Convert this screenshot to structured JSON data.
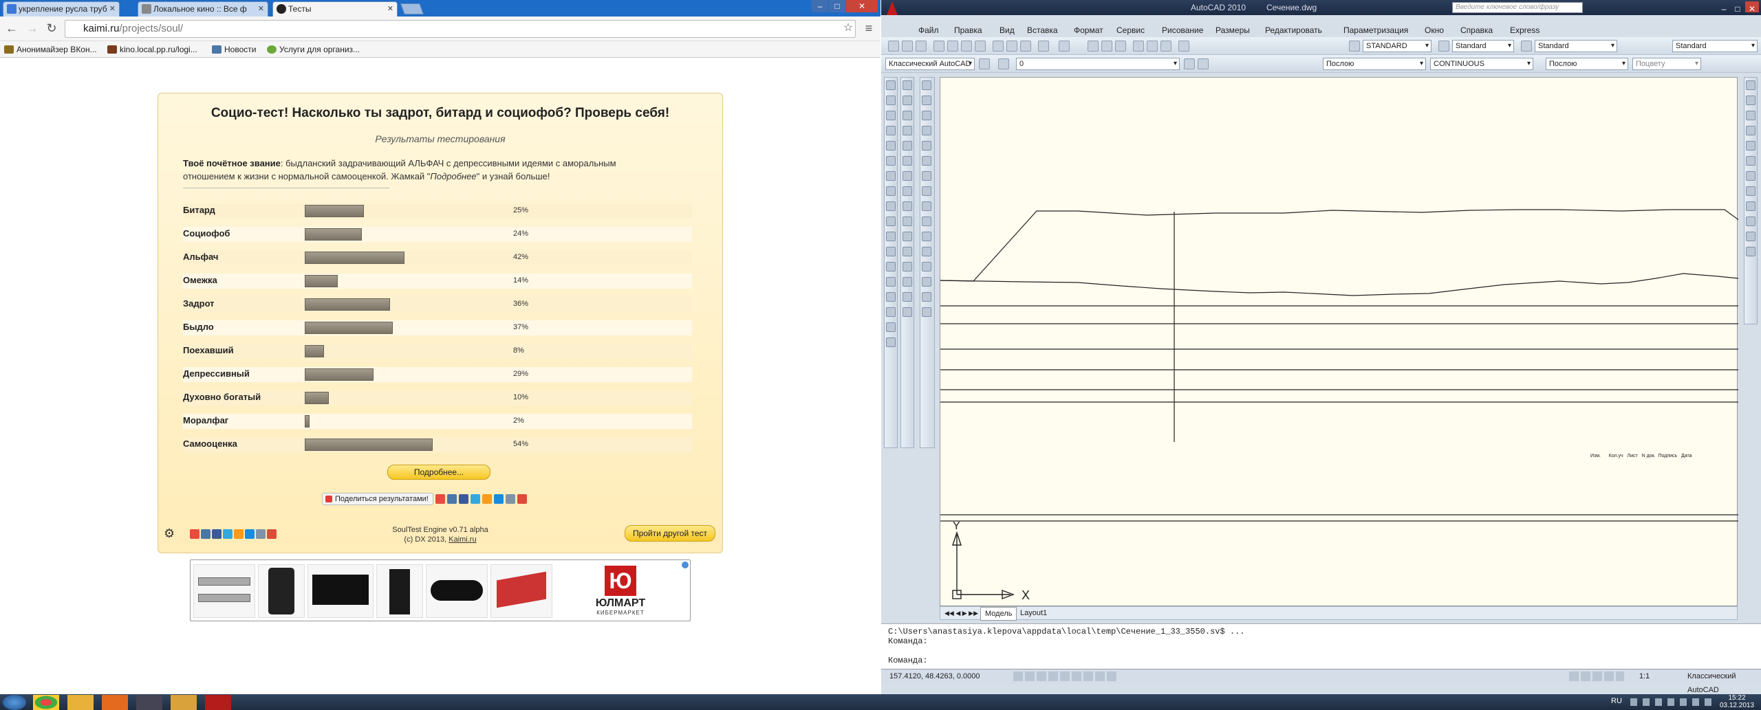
{
  "browser": {
    "tabs": [
      {
        "label": "укрепление русла труб"
      },
      {
        "label": "Локальное кино :: Все ф"
      },
      {
        "label": "Тесты"
      }
    ],
    "url_host": "kaimi.ru",
    "url_path": "/projects/soul/",
    "bookmarks": [
      {
        "label": "Анонимайзер ВКон..."
      },
      {
        "label": "kino.local.pp.ru/logi..."
      },
      {
        "label": "Новости"
      },
      {
        "label": "Услуги для организ..."
      }
    ]
  },
  "soul": {
    "title": "Социо-тест! Насколько ты задрот, битард и социофоб? Проверь себя!",
    "subtitle": "Результаты тестирования",
    "desc_bold": "Твоё почётное звание",
    "desc_text": ": быдланский задрачивающий АЛЬФАЧ с депрессивными идеями с аморальным отношением к жизни с нормальной самооценкой. Жамкай \"",
    "desc_italic": "Подробнее",
    "desc_tail": "\" и узнай больше!",
    "more_button": "Подробнее...",
    "share_button": "Поделиться результатами!",
    "engine": "SoulTest Engine v0.71 alpha",
    "copyright": "(c) DX 2013,",
    "copyright_link": "Kaimi.ru",
    "another_test": "Пройти другой тест"
  },
  "chart_data": {
    "type": "bar",
    "orientation": "horizontal",
    "categories": [
      "Битард",
      "Социофоб",
      "Альфач",
      "Омежка",
      "Задрот",
      "Быдло",
      "Поехавший",
      "Депрессивный",
      "Духовно богатый",
      "Моралфаг",
      "Самооценка"
    ],
    "values": [
      25,
      24,
      42,
      14,
      36,
      37,
      8,
      29,
      10,
      2,
      54
    ],
    "value_labels": [
      "25%",
      "24%",
      "42%",
      "14%",
      "36%",
      "37%",
      "8%",
      "29%",
      "10%",
      "2%",
      "54%"
    ],
    "xlim": [
      0,
      100
    ]
  },
  "ad": {
    "brand": "ЮЛМАРТ",
    "brand_sub": "КИБЕРМАРКЕТ"
  },
  "acad": {
    "app_title": "AutoCAD 2010",
    "file_title": "Сечение.dwg",
    "search_placeholder": "Введите ключевое слово/фразу",
    "menu": [
      "Файл",
      "Правка",
      "Вид",
      "Вставка",
      "Формат",
      "Сервис",
      "Рисование",
      "Размеры",
      "Редактировать",
      "Параметризация",
      "Окно",
      "Справка",
      "Express"
    ],
    "text_style": "STANDARD",
    "dim_style": "Standard",
    "table_style": "Standard",
    "multileader_style": "Standard",
    "workspace": "Классический AutoCAD",
    "layer": "0",
    "color": "Послою",
    "linetype": "CONTINUOUS",
    "lineweight": "Послою",
    "plot_style": "Поцвету",
    "tab_model": "Модель",
    "tab_layout": "Layout1",
    "stamp_headers": [
      "Изм.",
      "Кол.уч",
      "Лист",
      "N док.",
      "Подпись",
      "Дата"
    ],
    "cmd_lines": [
      "C:\\Users\\anastasiya.klepova\\appdata\\local\\temp\\Сечение_1_33_3550.sv$ ...",
      "Команда:",
      "Команда:"
    ],
    "coords": "157.4120, 48.4263, 0.0000",
    "status_workspace": "Классический AutoCAD",
    "scale": "1:1",
    "ucs_y": "Y",
    "ucs_x": "X"
  },
  "taskbar": {
    "lang": "RU",
    "time": "15:22",
    "date": "03.12.2013"
  }
}
